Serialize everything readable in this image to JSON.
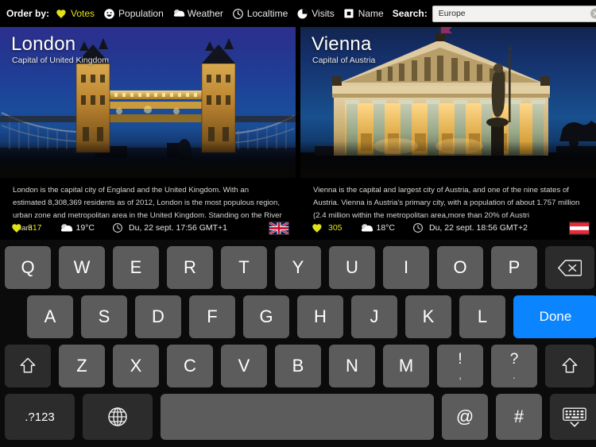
{
  "topbar": {
    "order_by_label": "Order by:",
    "order_items": [
      {
        "label": "Votes",
        "icon": "heart-icon",
        "active": true
      },
      {
        "label": "Population",
        "icon": "smiley-icon",
        "active": false
      },
      {
        "label": "Weather",
        "icon": "cloud-icon",
        "active": false
      },
      {
        "label": "Localtime",
        "icon": "clock-icon",
        "active": false
      },
      {
        "label": "Visits",
        "icon": "pie-chart-icon",
        "active": false
      },
      {
        "label": "Name",
        "icon": "square-box-icon",
        "active": false
      }
    ],
    "search_label": "Search:",
    "search_value": "Europe",
    "search_placeholder": "Search",
    "clear_icon": "clear-circle-icon",
    "accent_color": "#e2e21a",
    "done_color": "#0a84ff"
  },
  "cards": [
    {
      "title": "London",
      "subtitle": "Capital of United Kingdom",
      "photo_alt": "tower-bridge-night-photo",
      "description": "London is the capital city of England and the United Kingdom. With an estimated 8,308,369 residents as of 2012, London is the most populous region, urban zone and metropolitan area in the United Kingdom. Standing on the River Tham",
      "votes": "317",
      "temperature": "19°C",
      "localtime": "Du, 22 sept. 17:56 GMT+1",
      "flag": "flag-united-kingdom",
      "votes_icon": "heart-icon",
      "weather_icon": "cloud-icon",
      "clock_icon": "clock-icon"
    },
    {
      "title": "Vienna",
      "subtitle": "Capital of Austria",
      "photo_alt": "austrian-parliament-night-photo",
      "description": "Vienna is the capital and largest city of Austria, and one of the nine states of Austria. Vienna is Austria's primary city, with a population of about 1.757 million (2.4 million within the metropolitan area,more than 20% of Austri",
      "votes": "305",
      "temperature": "18°C",
      "localtime": "Du, 22 sept. 18:56 GMT+2",
      "flag": "flag-austria",
      "votes_icon": "heart-icon",
      "weather_icon": "cloud-icon",
      "clock_icon": "clock-icon"
    }
  ],
  "keyboard": {
    "row1": [
      "Q",
      "W",
      "E",
      "R",
      "T",
      "Y",
      "U",
      "I",
      "O",
      "P"
    ],
    "backspace_icon": "backspace-icon",
    "row2": [
      "A",
      "S",
      "D",
      "F",
      "G",
      "H",
      "J",
      "K",
      "L"
    ],
    "done_label": "Done",
    "row3": [
      "Z",
      "X",
      "C",
      "V",
      "B",
      "N",
      "M"
    ],
    "shift_icon": "shift-icon",
    "punct_keys": [
      {
        "top": "!",
        "bot": ","
      },
      {
        "top": "?",
        "bot": "."
      }
    ],
    "numeric_label": ".?123",
    "globe_icon": "globe-icon",
    "space_label": "",
    "at_label": "@",
    "hash_label": "#",
    "hide_keyboard_icon": "hide-keyboard-icon"
  }
}
